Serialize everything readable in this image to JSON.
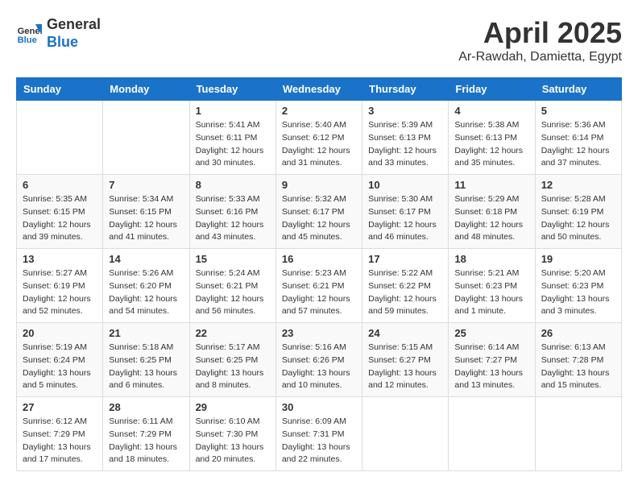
{
  "header": {
    "logo_line1": "General",
    "logo_line2": "Blue",
    "month": "April 2025",
    "location": "Ar-Rawdah, Damietta, Egypt"
  },
  "days_of_week": [
    "Sunday",
    "Monday",
    "Tuesday",
    "Wednesday",
    "Thursday",
    "Friday",
    "Saturday"
  ],
  "weeks": [
    [
      {
        "day": "",
        "sunrise": "",
        "sunset": "",
        "daylight": ""
      },
      {
        "day": "",
        "sunrise": "",
        "sunset": "",
        "daylight": ""
      },
      {
        "day": "1",
        "sunrise": "Sunrise: 5:41 AM",
        "sunset": "Sunset: 6:11 PM",
        "daylight": "Daylight: 12 hours and 30 minutes."
      },
      {
        "day": "2",
        "sunrise": "Sunrise: 5:40 AM",
        "sunset": "Sunset: 6:12 PM",
        "daylight": "Daylight: 12 hours and 31 minutes."
      },
      {
        "day": "3",
        "sunrise": "Sunrise: 5:39 AM",
        "sunset": "Sunset: 6:13 PM",
        "daylight": "Daylight: 12 hours and 33 minutes."
      },
      {
        "day": "4",
        "sunrise": "Sunrise: 5:38 AM",
        "sunset": "Sunset: 6:13 PM",
        "daylight": "Daylight: 12 hours and 35 minutes."
      },
      {
        "day": "5",
        "sunrise": "Sunrise: 5:36 AM",
        "sunset": "Sunset: 6:14 PM",
        "daylight": "Daylight: 12 hours and 37 minutes."
      }
    ],
    [
      {
        "day": "6",
        "sunrise": "Sunrise: 5:35 AM",
        "sunset": "Sunset: 6:15 PM",
        "daylight": "Daylight: 12 hours and 39 minutes."
      },
      {
        "day": "7",
        "sunrise": "Sunrise: 5:34 AM",
        "sunset": "Sunset: 6:15 PM",
        "daylight": "Daylight: 12 hours and 41 minutes."
      },
      {
        "day": "8",
        "sunrise": "Sunrise: 5:33 AM",
        "sunset": "Sunset: 6:16 PM",
        "daylight": "Daylight: 12 hours and 43 minutes."
      },
      {
        "day": "9",
        "sunrise": "Sunrise: 5:32 AM",
        "sunset": "Sunset: 6:17 PM",
        "daylight": "Daylight: 12 hours and 45 minutes."
      },
      {
        "day": "10",
        "sunrise": "Sunrise: 5:30 AM",
        "sunset": "Sunset: 6:17 PM",
        "daylight": "Daylight: 12 hours and 46 minutes."
      },
      {
        "day": "11",
        "sunrise": "Sunrise: 5:29 AM",
        "sunset": "Sunset: 6:18 PM",
        "daylight": "Daylight: 12 hours and 48 minutes."
      },
      {
        "day": "12",
        "sunrise": "Sunrise: 5:28 AM",
        "sunset": "Sunset: 6:19 PM",
        "daylight": "Daylight: 12 hours and 50 minutes."
      }
    ],
    [
      {
        "day": "13",
        "sunrise": "Sunrise: 5:27 AM",
        "sunset": "Sunset: 6:19 PM",
        "daylight": "Daylight: 12 hours and 52 minutes."
      },
      {
        "day": "14",
        "sunrise": "Sunrise: 5:26 AM",
        "sunset": "Sunset: 6:20 PM",
        "daylight": "Daylight: 12 hours and 54 minutes."
      },
      {
        "day": "15",
        "sunrise": "Sunrise: 5:24 AM",
        "sunset": "Sunset: 6:21 PM",
        "daylight": "Daylight: 12 hours and 56 minutes."
      },
      {
        "day": "16",
        "sunrise": "Sunrise: 5:23 AM",
        "sunset": "Sunset: 6:21 PM",
        "daylight": "Daylight: 12 hours and 57 minutes."
      },
      {
        "day": "17",
        "sunrise": "Sunrise: 5:22 AM",
        "sunset": "Sunset: 6:22 PM",
        "daylight": "Daylight: 12 hours and 59 minutes."
      },
      {
        "day": "18",
        "sunrise": "Sunrise: 5:21 AM",
        "sunset": "Sunset: 6:23 PM",
        "daylight": "Daylight: 13 hours and 1 minute."
      },
      {
        "day": "19",
        "sunrise": "Sunrise: 5:20 AM",
        "sunset": "Sunset: 6:23 PM",
        "daylight": "Daylight: 13 hours and 3 minutes."
      }
    ],
    [
      {
        "day": "20",
        "sunrise": "Sunrise: 5:19 AM",
        "sunset": "Sunset: 6:24 PM",
        "daylight": "Daylight: 13 hours and 5 minutes."
      },
      {
        "day": "21",
        "sunrise": "Sunrise: 5:18 AM",
        "sunset": "Sunset: 6:25 PM",
        "daylight": "Daylight: 13 hours and 6 minutes."
      },
      {
        "day": "22",
        "sunrise": "Sunrise: 5:17 AM",
        "sunset": "Sunset: 6:25 PM",
        "daylight": "Daylight: 13 hours and 8 minutes."
      },
      {
        "day": "23",
        "sunrise": "Sunrise: 5:16 AM",
        "sunset": "Sunset: 6:26 PM",
        "daylight": "Daylight: 13 hours and 10 minutes."
      },
      {
        "day": "24",
        "sunrise": "Sunrise: 5:15 AM",
        "sunset": "Sunset: 6:27 PM",
        "daylight": "Daylight: 13 hours and 12 minutes."
      },
      {
        "day": "25",
        "sunrise": "Sunrise: 6:14 AM",
        "sunset": "Sunset: 7:27 PM",
        "daylight": "Daylight: 13 hours and 13 minutes."
      },
      {
        "day": "26",
        "sunrise": "Sunrise: 6:13 AM",
        "sunset": "Sunset: 7:28 PM",
        "daylight": "Daylight: 13 hours and 15 minutes."
      }
    ],
    [
      {
        "day": "27",
        "sunrise": "Sunrise: 6:12 AM",
        "sunset": "Sunset: 7:29 PM",
        "daylight": "Daylight: 13 hours and 17 minutes."
      },
      {
        "day": "28",
        "sunrise": "Sunrise: 6:11 AM",
        "sunset": "Sunset: 7:29 PM",
        "daylight": "Daylight: 13 hours and 18 minutes."
      },
      {
        "day": "29",
        "sunrise": "Sunrise: 6:10 AM",
        "sunset": "Sunset: 7:30 PM",
        "daylight": "Daylight: 13 hours and 20 minutes."
      },
      {
        "day": "30",
        "sunrise": "Sunrise: 6:09 AM",
        "sunset": "Sunset: 7:31 PM",
        "daylight": "Daylight: 13 hours and 22 minutes."
      },
      {
        "day": "",
        "sunrise": "",
        "sunset": "",
        "daylight": ""
      },
      {
        "day": "",
        "sunrise": "",
        "sunset": "",
        "daylight": ""
      },
      {
        "day": "",
        "sunrise": "",
        "sunset": "",
        "daylight": ""
      }
    ]
  ]
}
